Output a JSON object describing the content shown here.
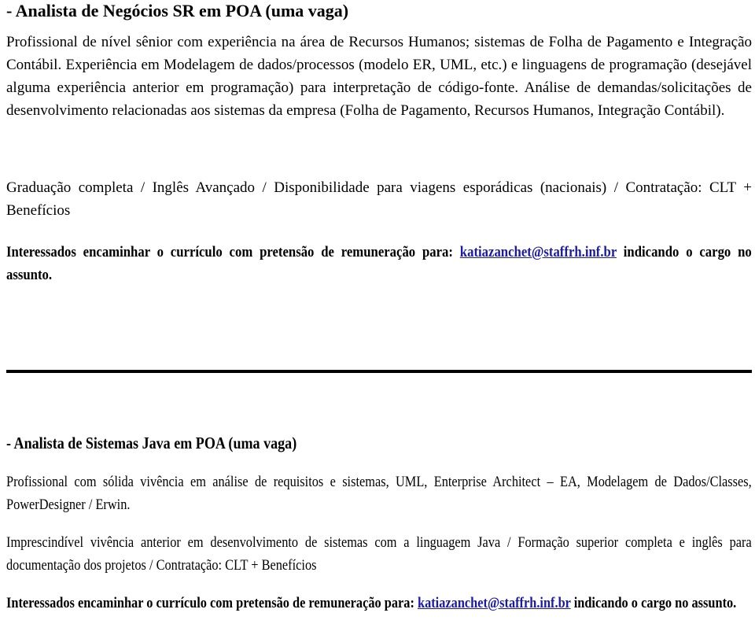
{
  "job1": {
    "title": "- Analista de Negócios SR em POA (uma vaga)",
    "description": "Profissional de nível sênior com experiência na área de Recursos Humanos; sistemas de Folha de Pagamento e Integração Contábil. Experiência em Modelagem de dados/processos (modelo ER, UML, etc.) e linguagens de programação (desejável alguma experiência anterior em programação) para interpretação de código-fonte. Análise de demandas/solicitações de desenvolvimento relacionadas aos sistemas da empresa (Folha de Pagamento, Recursos Humanos, Integração Contábil).",
    "requirements": "Graduação completa / Inglês Avançado / Disponibilidade para viagens esporádicas (nacionais) / Contratação: CLT + Benefícios",
    "apply_prefix": "Interessados encaminhar o currículo com pretensão de remuneração para:",
    "email": "katiazanchet@staffrh.inf.br",
    "apply_suffix": " indicando o cargo no assunto."
  },
  "job2": {
    "title": "- Analista de Sistemas Java em POA (uma vaga)",
    "description": "Profissional com sólida vivência em análise de requisitos e sistemas,  UML, Enterprise Architect – EA, Modelagem de Dados/Classes, PowerDesigner / Erwin.",
    "requirements": "Imprescindível vivência anterior em desenvolvimento de sistemas com a linguagem Java / Formação superior completa e inglês para documentação dos projetos / Contratação: CLT + Benefícios",
    "apply_prefix": "Interessados encaminhar o currículo com pretensão de remuneração para: ",
    "email": "katiazanchet@staffrh.inf.br",
    "apply_suffix": " indicando o cargo no assunto."
  }
}
